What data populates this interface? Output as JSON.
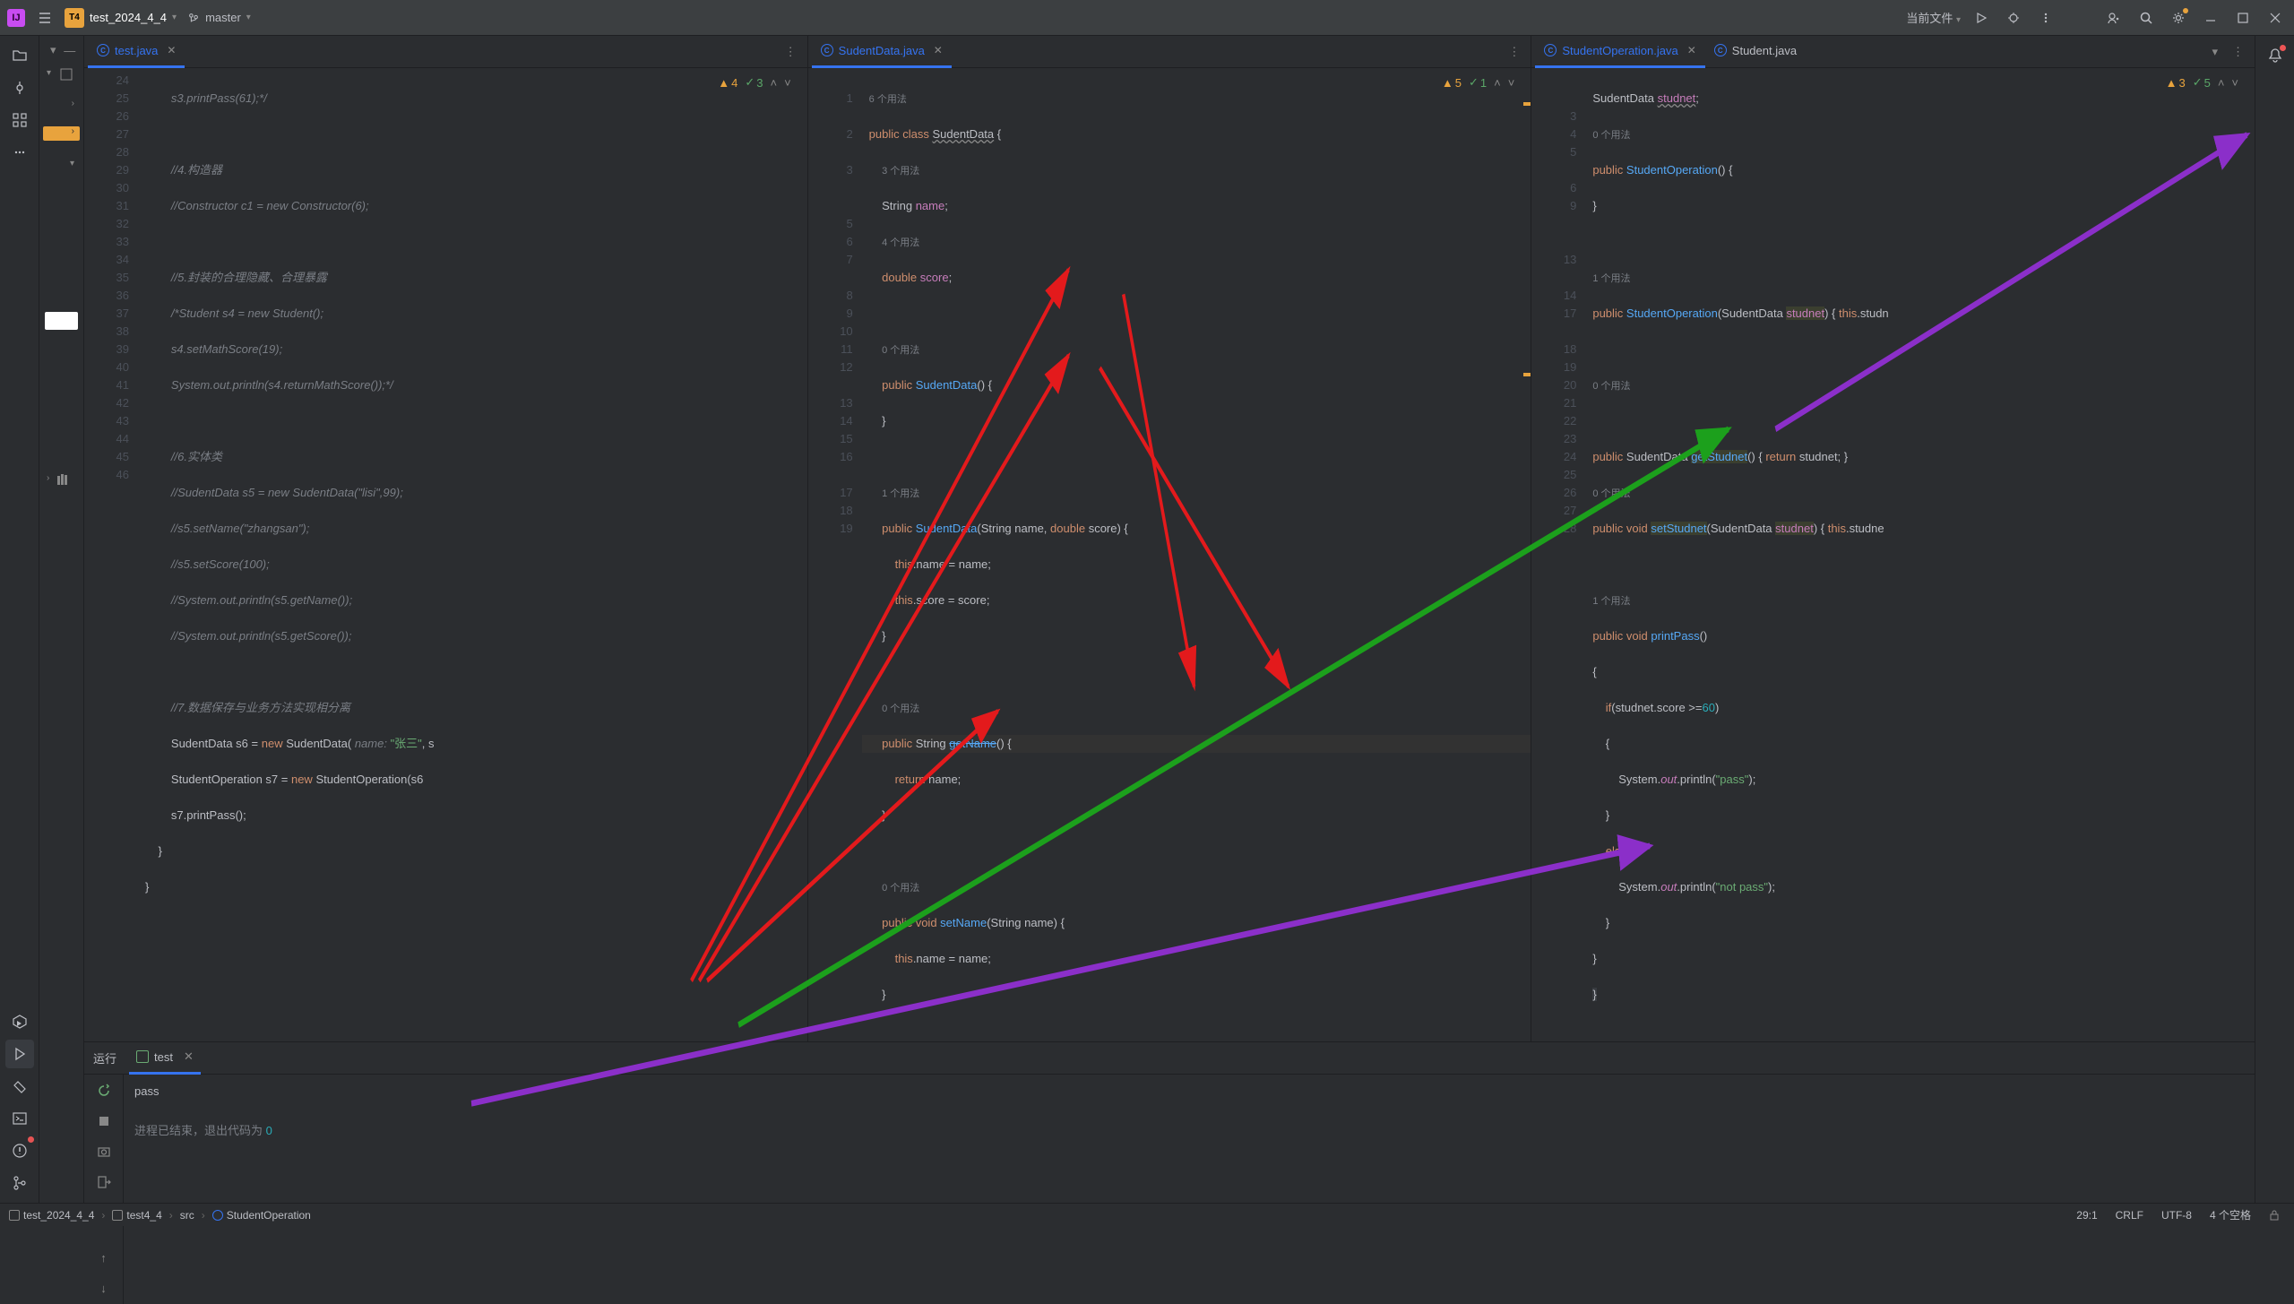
{
  "titleBar": {
    "projectBadge": "T4",
    "projectName": "test_2024_4_4",
    "branch": "master",
    "runConfig": "当前文件"
  },
  "tabs": {
    "left": [
      {
        "name": "test.java",
        "active": true
      }
    ],
    "mid": [
      {
        "name": "SudentData.java",
        "active": true
      }
    ],
    "right": [
      {
        "name": "StudentOperation.java",
        "active": true
      },
      {
        "name": "Student.java",
        "active": false
      }
    ]
  },
  "inspections": {
    "left": {
      "warn": "4",
      "check": "3"
    },
    "mid": {
      "warn": "5",
      "check": "1"
    },
    "right": {
      "warn": "3",
      "check": "5"
    }
  },
  "gutterLeft": [
    "24",
    "25",
    "26",
    "27",
    "28",
    "29",
    "30",
    "31",
    "32",
    "33",
    "34",
    "35",
    "36",
    "37",
    "38",
    "39",
    "40",
    "41",
    "42",
    "43",
    "44",
    "45",
    "46"
  ],
  "codeLeft": {
    "l24": "s3.printPass(61);*/",
    "l26": "//4.构造器",
    "l27": "//Constructor c1 = new Constructor(6);",
    "l29": "//5.封装的合理隐藏、合理暴露",
    "l30": "/*Student s4 = new Student();",
    "l31": "s4.setMathScore(19);",
    "l32": "System.out.println(s4.returnMathScore());*/",
    "l34": "//6.实体类",
    "l35": "//SudentData s5 = new SudentData(\"lisi\",99);",
    "l36": "//s5.setName(\"zhangsan\");",
    "l37": "//s5.setScore(100);",
    "l38": "//System.out.println(s5.getName());",
    "l39": "//System.out.println(s5.getScore());",
    "l41": "//7.数据保存与业务方法实现相分离",
    "l42a": "SudentData s6 = ",
    "l42b": "new",
    "l42c": " SudentData( ",
    "l42d": "name:",
    "l42e": " \"张三\"",
    "l42f": ", s",
    "l43a": "StudentOperation s7 = ",
    "l43b": "new",
    "l43c": " StudentOperation(s6",
    "l44": "s7.printPass();",
    "l45": "}",
    "l46": "}"
  },
  "gutterMid": [
    "",
    "1",
    "",
    "2",
    "",
    "3",
    "",
    "",
    "5",
    "6",
    "7",
    "",
    "8",
    "9",
    "10",
    "11",
    "12",
    "",
    "13",
    "14",
    "15",
    "16",
    "",
    "17",
    "18",
    "19"
  ],
  "codeMid": {
    "u0": "6 个用法",
    "l1a": "public class ",
    "l1b": "SudentData",
    "l1c": " {",
    "u1": "3 个用法",
    "l2a": "String ",
    "l2b": "name",
    "l2c": ";",
    "u2": "4 个用法",
    "l3a": "double ",
    "l3b": "score",
    "l3c": ";",
    "u3": "0 个用法",
    "l5a": "public ",
    "l5b": "SudentData",
    "l5c": "() {",
    "l6": "}",
    "u4": "1 个用法",
    "l8a": "public ",
    "l8b": "SudentData",
    "l8c": "(String name, ",
    "l8d": "double",
    "l8e": " score) {",
    "l9a": "this",
    "l9b": ".name = name;",
    "l10a": "this",
    "l10b": ".score = score;",
    "l11": "}",
    "u5": "0 个用法",
    "l13a": "public ",
    "l13b": "String ",
    "l13c": "getName",
    "l13d": "() {",
    "l14a": "return ",
    "l14b": "name;",
    "l15": "}",
    "u6": "0 个用法",
    "l17a": "public void ",
    "l17b": "setName",
    "l17c": "(String name) {",
    "l18a": "this",
    "l18b": ".name = name;",
    "l19": "}"
  },
  "gutterRight": [
    "",
    "",
    "3",
    "4",
    "5",
    "",
    "6",
    "9",
    "",
    "",
    "13",
    "",
    "14",
    "17",
    "",
    "18",
    "19",
    "20",
    "21",
    "22",
    "23",
    "24",
    "25",
    "26",
    "27",
    "28"
  ],
  "codeRight": {
    "l1a": "SudentData ",
    "l1b": "studnet",
    "l1c": ";",
    "u1": "0 个用法",
    "l3a": "public ",
    "l3b": "StudentOperation",
    "l3c": "() {",
    "l4": "}",
    "u2": "1 个用法",
    "l6a": "public ",
    "l6b": "StudentOperation",
    "l6c": "(SudentData ",
    "l6d": "studnet",
    "l6e": ") { ",
    "l6f": "this",
    "l6g": ".studn",
    "u3": "0 个用法",
    "l10a": "public ",
    "l10b": "SudentData ",
    "l10c": "getStudnet",
    "l10d": "() { ",
    "l10e": "return",
    "l10f": " studnet; }",
    "u4": "0 个用法",
    "l14a": "public void ",
    "l14b": "setStudnet",
    "l14c": "(SudentData ",
    "l14d": "studnet",
    "l14e": ") { ",
    "l14f": "this",
    "l14g": ".studne",
    "u5": "1 个用法",
    "l18a": "public void ",
    "l18b": "printPass",
    "l18c": "()",
    "l19": "{",
    "l20a": "if",
    "l20b": "(studnet.score >=",
    "l20c": "60",
    "l20d": ")",
    "l21": "{",
    "l22a": "System.",
    "l22b": "out",
    "l22c": ".println(",
    "l22d": "\"pass\"",
    "l22e": ");",
    "l23": "}",
    "l24a": "else",
    "l24b": " {",
    "l25a": "System.",
    "l25b": "out",
    "l25c": ".println(",
    "l25d": "\"not pass\"",
    "l25e": ");",
    "l26": "}",
    "l27": "}",
    "l28": "}"
  },
  "runPanel": {
    "label": "运行",
    "tabName": "test",
    "output": "pass",
    "exitMsg": "进程已结束，退出代码为 ",
    "exitCode": "0"
  },
  "breadcrumb": {
    "b1": "test_2024_4_4",
    "b2": "test4_4",
    "b3": "src",
    "b4": "StudentOperation"
  },
  "statusBar": {
    "pos": "29:1",
    "lineSep": "CRLF",
    "encoding": "UTF-8",
    "indent": "4 个空格"
  }
}
